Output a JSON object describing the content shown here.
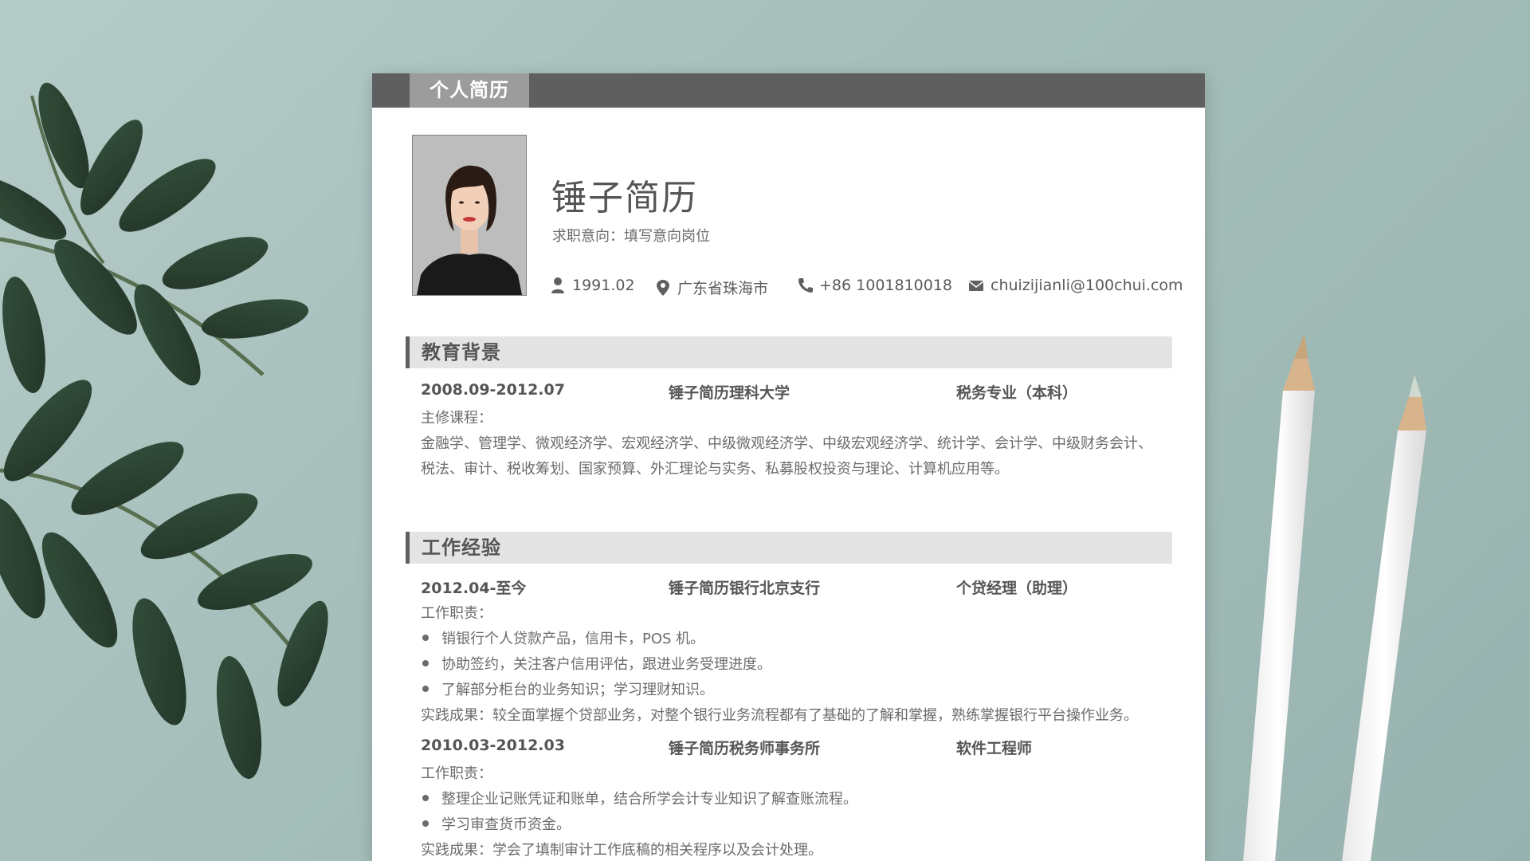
{
  "header": {
    "tab_label": "个人简历"
  },
  "profile": {
    "name": "锤子简历",
    "intent": "求职意向：填写意向岗位",
    "birth": "1991.02",
    "location": "广东省珠海市",
    "phone": "+86 1001810018",
    "email": "chuizijianli@100chui.com"
  },
  "education": {
    "title": "教育背景",
    "period": "2008.09-2012.07",
    "school": "锤子简历理科大学",
    "major": "税务专业（本科）",
    "courses_label": "主修课程：",
    "courses_line1": "金融学、管理学、微观经济学、宏观经济学、中级微观经济学、中级宏观经济学、统计学、会计学、中级财务会计、",
    "courses_line2": "税法、审计、税收筹划、国家预算、外汇理论与实务、私募股权投资与理论、计算机应用等。"
  },
  "work": {
    "title": "工作经验",
    "jobs": [
      {
        "period": "2012.04-至今",
        "company": "锤子简历银行北京支行",
        "position": "个贷经理（助理）",
        "duties_label": "工作职责：",
        "duties": [
          "销银行个人贷款产品，信用卡，POS 机。",
          "协助签约，关注客户信用评估，跟进业务受理进度。",
          "了解部分柜台的业务知识；学习理财知识。"
        ],
        "result": "实践成果：较全面掌握个贷部业务，对整个银行业务流程都有了基础的了解和掌握，熟练掌握银行平台操作业务。"
      },
      {
        "period": "2010.03-2012.03",
        "company": "锤子简历税务师事务所",
        "position": "软件工程师",
        "duties_label": "工作职责：",
        "duties": [
          "整理企业记账凭证和账单，结合所学会计专业知识了解查账流程。",
          "学习审查货币资金。"
        ],
        "result": "实践成果：学会了填制审计工作底稿的相关程序以及会计处理。"
      }
    ]
  },
  "icons": {
    "birth": "user-icon",
    "location": "map-pin-icon",
    "phone": "phone-icon",
    "email": "envelope-icon"
  },
  "colors": {
    "background": "#a3bdb9",
    "topbar": "#5f5f5f",
    "tab": "#9c9c9c",
    "section_bg": "#e4e4e4",
    "text": "#555555"
  }
}
